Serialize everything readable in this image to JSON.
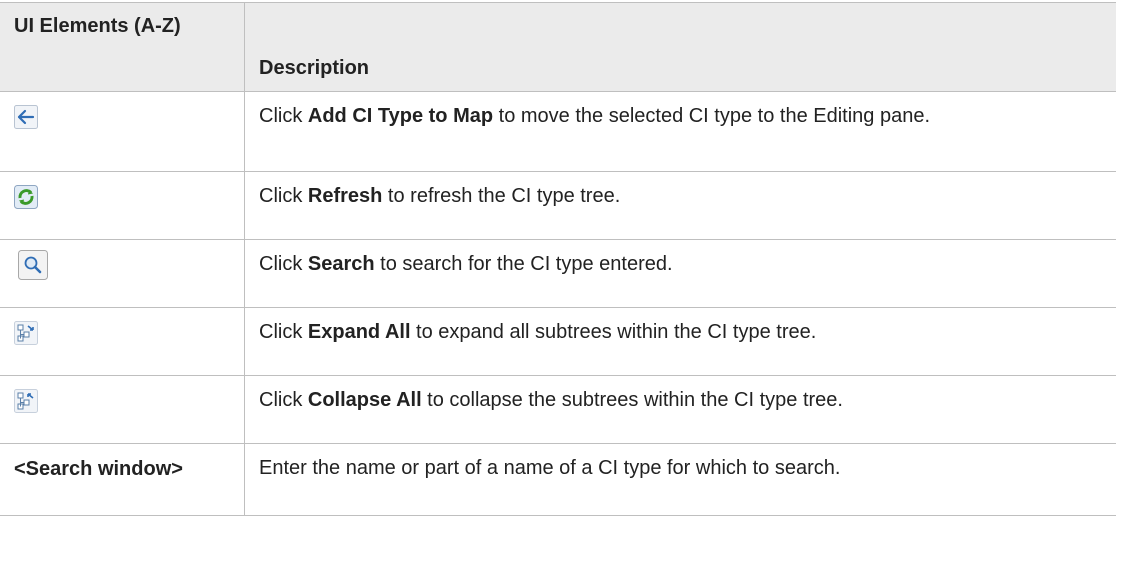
{
  "table": {
    "header": {
      "col1": "UI Elements (A-Z)",
      "col2": "Description"
    },
    "rows": [
      {
        "icon": "arrow-left-icon",
        "pre": "Click ",
        "bold": "Add CI Type to Map",
        "post": " to move the selected CI type to the Editing pane."
      },
      {
        "icon": "refresh-icon",
        "pre": "Click ",
        "bold": "Refresh",
        "post": " to refresh the CI type tree."
      },
      {
        "icon": "search-icon",
        "pre": "Click ",
        "bold": "Search",
        "post": " to search for the CI type entered."
      },
      {
        "icon": "expand-all-icon",
        "pre": "Click ",
        "bold": "Expand All",
        "post": " to expand all subtrees within the CI type tree."
      },
      {
        "icon": "collapse-all-icon",
        "pre": "Click ",
        "bold": "Collapse All",
        "post": " to collapse the subtrees within the CI type tree."
      },
      {
        "element": "<Search window>",
        "description": "Enter the name or part of a name of a CI type for which to search."
      }
    ]
  },
  "colors": {
    "header_bg": "#ebebeb",
    "border": "#bfbfbf",
    "icon_blue": "#2f6db5",
    "icon_green": "#3a9a2a"
  }
}
